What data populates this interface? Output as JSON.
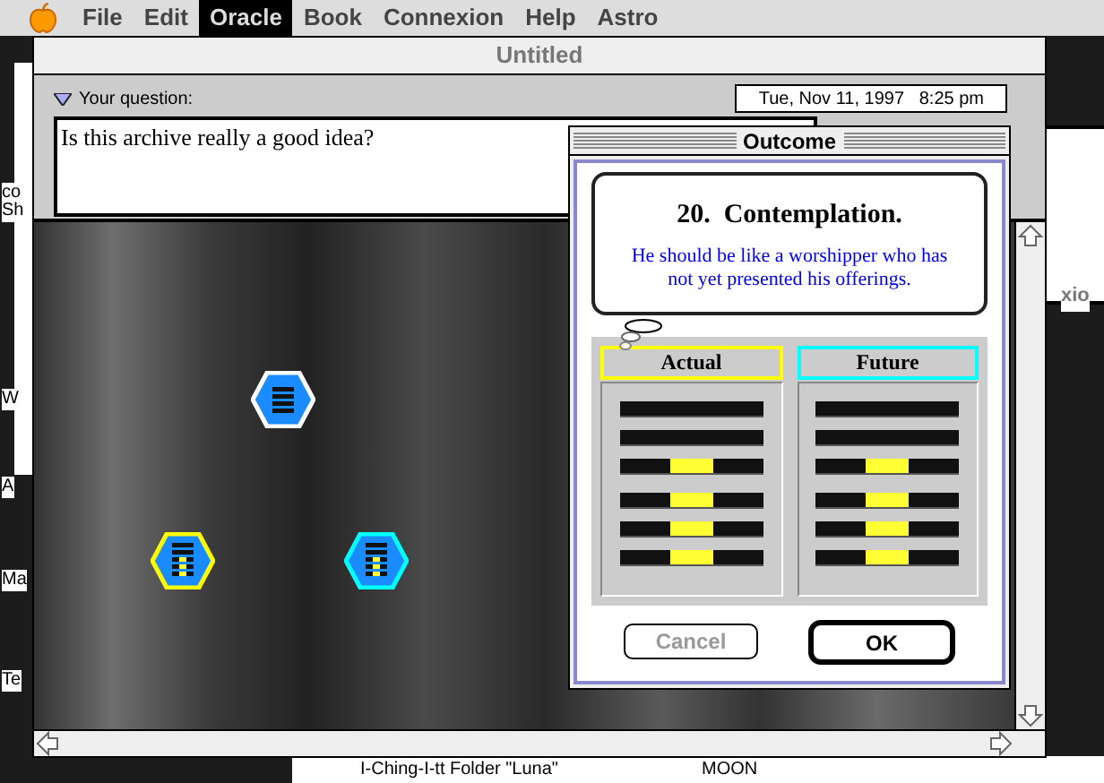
{
  "menu_bar": {
    "items": [
      {
        "label": "File",
        "selected": false
      },
      {
        "label": "Edit",
        "selected": false
      },
      {
        "label": "Oracle",
        "selected": true
      },
      {
        "label": "Book",
        "selected": false
      },
      {
        "label": "Connexion",
        "selected": false
      },
      {
        "label": "Help",
        "selected": false
      },
      {
        "label": "Astro",
        "selected": false
      }
    ]
  },
  "background_fragments": {
    "left": [
      "co",
      "Sh",
      "W",
      "A",
      "Ma",
      "Te"
    ],
    "right": "xio",
    "bottom": [
      "I-Ching-I-tt Folder \"Luna\"",
      "MOON"
    ]
  },
  "window": {
    "title": "Untitled",
    "question_label": "Your question:",
    "date": "Tue, Nov 11, 1997   8:25 pm",
    "question": "Is this archive really a good idea?"
  },
  "outcome": {
    "title": "Outcome",
    "heading": "20.  Contemplation.",
    "text": "He should be like a worshipper who has not yet presented his offerings.",
    "columns": [
      {
        "label": "Actual",
        "color": "#ffff00",
        "lines": [
          {
            "kind": "solid"
          },
          {
            "kind": "solid"
          },
          {
            "kind": "broken"
          },
          {
            "kind": "broken"
          },
          {
            "kind": "broken"
          },
          {
            "kind": "broken"
          }
        ]
      },
      {
        "label": "Future",
        "color": "#00ffff",
        "lines": [
          {
            "kind": "solid"
          },
          {
            "kind": "solid"
          },
          {
            "kind": "broken"
          },
          {
            "kind": "broken"
          },
          {
            "kind": "broken"
          },
          {
            "kind": "broken"
          }
        ]
      }
    ],
    "buttons": [
      {
        "label": "Cancel",
        "disabled": true,
        "default": false
      },
      {
        "label": "OK",
        "disabled": false,
        "default": true
      }
    ]
  }
}
